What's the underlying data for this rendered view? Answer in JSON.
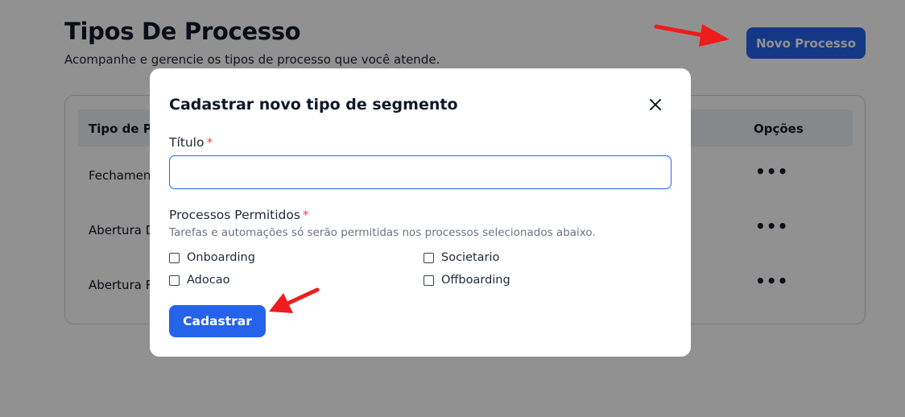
{
  "page": {
    "title": "Tipos De Processo",
    "subtitle": "Acompanhe e gerencie os tipos de processo que você atende.",
    "new_button": "Novo Processo"
  },
  "table": {
    "columns": [
      "Tipo de Pr",
      "Opções"
    ],
    "rows": [
      {
        "type": "Fechamen",
        "options_icon": "more-horizontal-icon"
      },
      {
        "type": "Abertura D",
        "options_icon": "more-horizontal-icon"
      },
      {
        "type": "Abertura R",
        "options_icon": "more-horizontal-icon"
      }
    ]
  },
  "modal": {
    "title": "Cadastrar novo tipo de segmento",
    "close_icon": "close-icon",
    "title_field": {
      "label": "Título",
      "required_mark": "*",
      "value": ""
    },
    "processes": {
      "label": "Processos Permitidos",
      "required_mark": "*",
      "hint": "Tarefas e automações só serão permitidas nos processos selecionados abaixo.",
      "options": [
        {
          "label": "Onboarding",
          "checked": false
        },
        {
          "label": "Societario",
          "checked": false
        },
        {
          "label": "Adocao",
          "checked": false
        },
        {
          "label": "Offboarding",
          "checked": false
        }
      ]
    },
    "submit_button": "Cadastrar"
  },
  "colors": {
    "primary": "#2563eb",
    "required": "#ef4444",
    "annotation_arrow": "#ef1c1c"
  }
}
